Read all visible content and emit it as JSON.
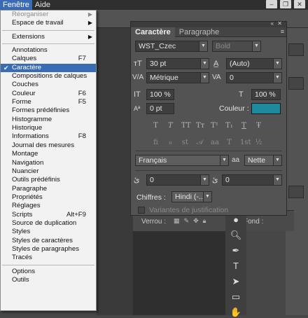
{
  "menubar": {
    "items": [
      "Fenêtre",
      "Aide"
    ],
    "window_buttons": [
      "–",
      "❐",
      "✕"
    ]
  },
  "menu": {
    "items": [
      {
        "label": "Réorganiser",
        "disabled": true,
        "submenu": true
      },
      {
        "label": "Espace de travail",
        "submenu": true
      },
      {
        "sep": true
      },
      {
        "label": "Extensions",
        "submenu": true
      },
      {
        "sep": true
      },
      {
        "label": "Annotations"
      },
      {
        "label": "Calques",
        "shortcut": "F7"
      },
      {
        "label": "Caractère",
        "selected": true,
        "checked": true
      },
      {
        "label": "Compositions de calques"
      },
      {
        "label": "Couches"
      },
      {
        "label": "Couleur",
        "shortcut": "F6"
      },
      {
        "label": "Forme",
        "shortcut": "F5"
      },
      {
        "label": "Formes prédéfinies"
      },
      {
        "label": "Histogramme"
      },
      {
        "label": "Historique"
      },
      {
        "label": "Informations",
        "shortcut": "F8"
      },
      {
        "label": "Journal des mesures"
      },
      {
        "label": "Montage"
      },
      {
        "label": "Navigation"
      },
      {
        "label": "Nuancier"
      },
      {
        "label": "Outils prédéfinis"
      },
      {
        "label": "Paragraphe"
      },
      {
        "label": "Propriétés"
      },
      {
        "label": "Réglages"
      },
      {
        "label": "Scripts",
        "shortcut": "Alt+F9"
      },
      {
        "label": "Source de duplication"
      },
      {
        "label": "Styles"
      },
      {
        "label": "Styles de caractères"
      },
      {
        "label": "Styles de paragraphes"
      },
      {
        "label": "Tracés"
      },
      {
        "sep": true
      },
      {
        "label": "Options"
      },
      {
        "label": "Outils"
      }
    ]
  },
  "panel": {
    "tabs": [
      "Caractère",
      "Paragraphe"
    ],
    "font_family": "WST_Czec",
    "font_style": "Bold",
    "font_size": "30 pt",
    "leading": "(Auto)",
    "kerning": "Métrique",
    "tracking": "0",
    "vertical_scale": "100 %",
    "horizontal_scale": "100 %",
    "baseline_shift": "0 pt",
    "color_label": "Couleur :",
    "color_value": "#1e8aa0",
    "style_buttons": [
      "T",
      "T",
      "TT",
      "Tт",
      "T¹",
      "T₁",
      "T",
      "Ŧ"
    ],
    "opentype_buttons": [
      "fi",
      "ℴ",
      "st",
      "𝒜",
      "aa",
      "T",
      "1st",
      "½"
    ],
    "language": "Français",
    "antialias_label": "aa",
    "antialias": "Nette",
    "tsume_left": "0",
    "tsume_right": "0",
    "digits_label": "Chiffres :",
    "digits_value": "Hindi (-...",
    "justification_label": "Variantes de justification"
  },
  "layers": {
    "lock_label": "Verrou :",
    "fond_label": "Fond :"
  },
  "colors": {
    "menu_highlight": "#3a6bb5",
    "panel_bg": "#535353",
    "swatch": "#1e8aa0"
  }
}
